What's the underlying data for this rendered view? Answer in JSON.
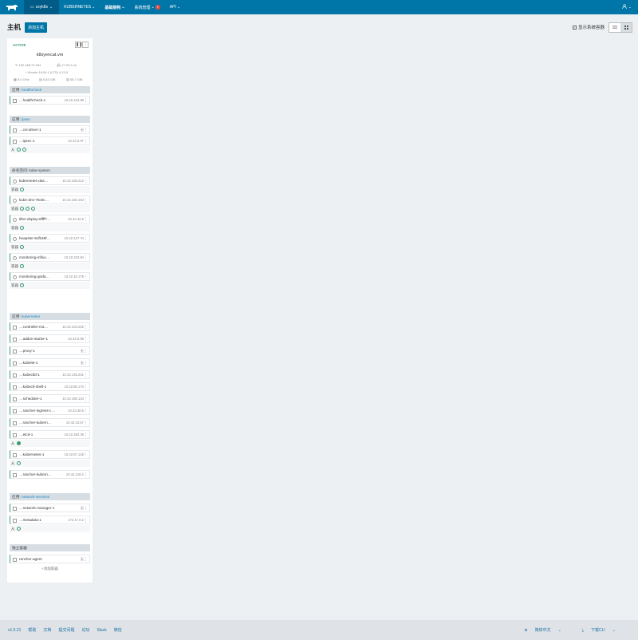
{
  "nav": {
    "env": "sxyk8s",
    "items": [
      "KUBERNETES",
      "基础架构",
      "系统管理",
      "API"
    ],
    "warn_count": "!"
  },
  "page": {
    "title": "主机",
    "add_host": "添加主机",
    "show_system": "显示系统容器"
  },
  "host": {
    "state": "ACTIVE",
    "name": "k8syencat.vm",
    "ip": "192.168.74.534",
    "docker": "17.03.2-ce",
    "os": "Ubuntu 16.04.1 (LTS) 4.13.0",
    "cpu": "8.0 GHz",
    "ram": "5.83 GiB",
    "disk": "58.7 GiB"
  },
  "stacks": [
    {
      "prefix": "应用:",
      "name": "healthcheck",
      "rows": [
        {
          "name": "…healthcheck-1",
          "ip": "10.42.132.98",
          "sq": true
        }
      ],
      "footer": ""
    },
    {
      "prefix": "应用:",
      "name": "ipsec",
      "rows": [
        {
          "name": "…cni-driver-1",
          "ip": "无",
          "sq": true
        },
        {
          "name": "…ipsec-1",
          "ip": "10.42.2.97",
          "sq": true
        }
      ],
      "footer": "从"
    },
    {
      "prefix": "",
      "name": "命名空间: kube-system",
      "rows": [
        {
          "name": "kubernetes-das…",
          "ip": "10.42.158.212",
          "sub": "容器"
        },
        {
          "name": "kube-dns-75c8c…",
          "ip": "10.42.183.153",
          "sub": "容器"
        },
        {
          "name": "tiller-deploy-6ffff7…",
          "ip": "10.42.42.8",
          "sub": "容器"
        },
        {
          "name": "heapster-6cfb49f…",
          "ip": "10.42.127.74",
          "sub": "容器"
        },
        {
          "name": "monitoring-influx…",
          "ip": "10.42.222.84",
          "sub": "容器"
        },
        {
          "name": "monitoring-grafa…",
          "ip": "10.42.16.179",
          "sub": "容器"
        }
      ],
      "footer": ""
    },
    {
      "prefix": "应用:",
      "name": "kubernetes",
      "rows": [
        {
          "name": "…controller-ma…",
          "ip": "10.42.104.226",
          "sq": true
        },
        {
          "name": "…addon-starter-1",
          "ip": "10.42.0.88",
          "sq": true
        },
        {
          "name": "…proxy-1",
          "ip": "无",
          "sq": true
        },
        {
          "name": "…kubelet-1",
          "ip": "无",
          "sq": true
        },
        {
          "name": "…kubectld-1",
          "ip": "10.42.148.201",
          "sq": true
        },
        {
          "name": "…kubectl-shell-1",
          "ip": "10.42.80.170",
          "sq": true
        },
        {
          "name": "…scheduler-1",
          "ip": "10.42.166.123",
          "sq": true
        },
        {
          "name": "…rancher-ingress-c…",
          "ip": "10.42.30.6",
          "sq": true
        },
        {
          "name": "…rancher-kubern…",
          "ip": "10.42.23.57",
          "sq": true
        },
        {
          "name": "…etcd-1",
          "ip": "10.42.182.38",
          "sq": true,
          "sub": "从"
        },
        {
          "name": "…kubernetes-1",
          "ip": "10.42.67.128",
          "sq": true,
          "sub": "从"
        },
        {
          "name": "…rancher-kubern…",
          "ip": "10.42.219.2",
          "sq": true
        }
      ],
      "footer": ""
    },
    {
      "prefix": "应用:",
      "name": "network-services",
      "rows": [
        {
          "name": "…network-manager-1",
          "ip": "无",
          "sq": true
        },
        {
          "name": "…metadata-1",
          "ip": "172.17.0.2",
          "sq": true
        }
      ],
      "footer": "从"
    },
    {
      "prefix": "",
      "name": "独立容器",
      "rows": [
        {
          "name": "rancher-agent",
          "ip": "无",
          "sq": true
        }
      ],
      "footer": "",
      "add": "添加容器"
    }
  ],
  "footer": {
    "version": "v1.6.21",
    "links": [
      "帮助",
      "文档",
      "提交问题",
      "论坛",
      "Slack",
      "微信"
    ],
    "lang": "简体中文",
    "cli": "下载CLI"
  },
  "colors": {
    "primary": "#0075a8",
    "active": "#3d9970",
    "navdark": "#005b86"
  }
}
